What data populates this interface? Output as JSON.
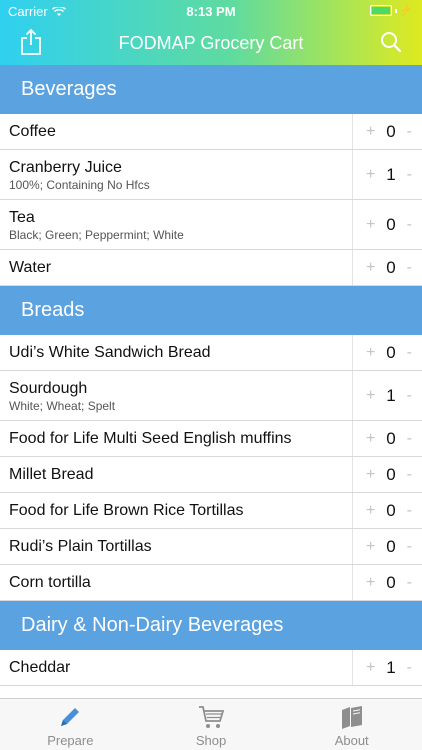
{
  "status_bar": {
    "carrier": "Carrier",
    "time": "8:13 PM"
  },
  "nav": {
    "title": "FODMAP Grocery Cart"
  },
  "colors": {
    "section_header": "#5aa2e0",
    "gradient_start": "#2fd0f0",
    "gradient_end": "#dfe91f"
  },
  "stepper": {
    "plus": "+",
    "minus": "-"
  },
  "sections": [
    {
      "title": "Beverages",
      "items": [
        {
          "name": "Coffee",
          "subtitle": "",
          "count": "0"
        },
        {
          "name": "Cranberry Juice",
          "subtitle": "100%; Containing No Hfcs",
          "count": "1"
        },
        {
          "name": "Tea",
          "subtitle": "Black; Green; Peppermint; White",
          "count": "0"
        },
        {
          "name": "Water",
          "subtitle": "",
          "count": "0"
        }
      ]
    },
    {
      "title": "Breads",
      "items": [
        {
          "name": "Udi’s White Sandwich Bread",
          "subtitle": "",
          "count": "0"
        },
        {
          "name": "Sourdough",
          "subtitle": "White; Wheat; Spelt",
          "count": "1"
        },
        {
          "name": "Food for Life Multi Seed English muffins",
          "subtitle": "",
          "count": "0"
        },
        {
          "name": "Millet Bread",
          "subtitle": "",
          "count": "0"
        },
        {
          "name": "Food for Life Brown Rice Tortillas",
          "subtitle": "",
          "count": "0"
        },
        {
          "name": "Rudi’s Plain Tortillas",
          "subtitle": "",
          "count": "0"
        },
        {
          "name": "Corn tortilla",
          "subtitle": "",
          "count": "0"
        }
      ]
    },
    {
      "title": "Dairy & Non-Dairy Beverages",
      "items": [
        {
          "name": "Cheddar",
          "subtitle": "",
          "count": "1"
        }
      ]
    }
  ],
  "tabs": [
    {
      "label": "Prepare",
      "icon": "pencil-icon"
    },
    {
      "label": "Shop",
      "icon": "cart-icon"
    },
    {
      "label": "About",
      "icon": "books-icon"
    }
  ]
}
